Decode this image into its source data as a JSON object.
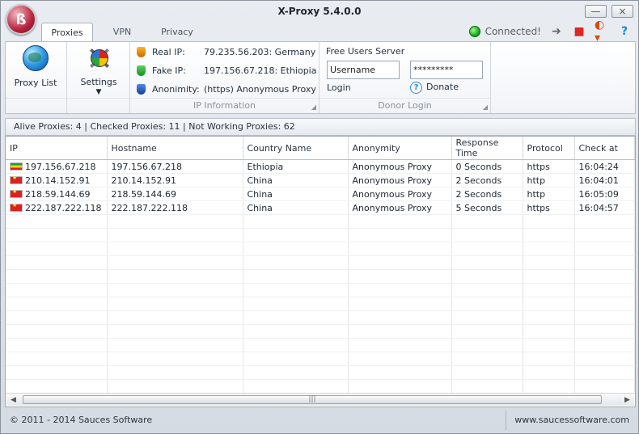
{
  "window": {
    "title": "X-Proxy 5.4.0.0"
  },
  "window_controls": {
    "minimize": "—",
    "close": "×"
  },
  "tabs": [
    {
      "label": "Proxies",
      "active": true
    },
    {
      "label": "VPN",
      "active": false
    },
    {
      "label": "Privacy",
      "active": false
    }
  ],
  "status": {
    "text": "Connected!",
    "color": "#22b629"
  },
  "ribbon": {
    "proxy_list_label": "Proxy List",
    "settings_label": "Settings",
    "ip_info": {
      "group_title": "IP Information",
      "rows": [
        {
          "label": "Real IP:",
          "value": "79.235.56.203: Germany",
          "icon": "orange-shield-icon"
        },
        {
          "label": "Fake IP:",
          "value": "197.156.67.218: Ethiopia",
          "icon": "green-shield-icon"
        },
        {
          "label": "Anonimity:",
          "value": "(https) Anonymous Proxy",
          "icon": "blue-shield-icon"
        }
      ]
    },
    "donor": {
      "group_title": "Donor Login",
      "server_label": "Free Users Server",
      "username": "Username",
      "password": "*********",
      "login_label": "Login",
      "donate_label": "Donate"
    }
  },
  "summary": "Alive Proxies: 4 | Checked Proxies: 11 | Not Working Proxies: 62",
  "table": {
    "headers": [
      "IP",
      "Hostname",
      "Country Name",
      "Anonymity",
      "Response Time",
      "Protocol",
      "Check at"
    ],
    "rows": [
      {
        "flag": "ethiopia",
        "ip": "197.156.67.218",
        "hostname": "197.156.67.218",
        "country": "Ethiopia",
        "anonymity": "Anonymous Proxy",
        "response": "0 Seconds",
        "protocol": "https",
        "check": "16:04:24"
      },
      {
        "flag": "china",
        "ip": "210.14.152.91",
        "hostname": "210.14.152.91",
        "country": "China",
        "anonymity": "Anonymous Proxy",
        "response": "2 Seconds",
        "protocol": "http",
        "check": "16:04:01"
      },
      {
        "flag": "china",
        "ip": "218.59.144.69",
        "hostname": "218.59.144.69",
        "country": "China",
        "anonymity": "Anonymous Proxy",
        "response": "2 Seconds",
        "protocol": "http",
        "check": "16:05:09"
      },
      {
        "flag": "china",
        "ip": "222.187.222.118",
        "hostname": "222.187.222.118",
        "country": "China",
        "anonymity": "Anonymous Proxy",
        "response": "5 Seconds",
        "protocol": "https",
        "check": "16:04:57"
      }
    ]
  },
  "scrollbar": {
    "left_arrow": "◀",
    "right_arrow": "▶",
    "grip": "|||"
  },
  "footer": {
    "copyright": "© 2011 - 2014 Sauces Software",
    "website": "www.saucessoftware.com"
  }
}
